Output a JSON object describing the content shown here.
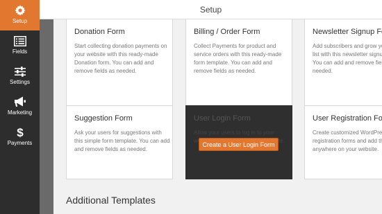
{
  "app": {
    "title": "Setup"
  },
  "sidebar": {
    "items": [
      {
        "label": "Setup",
        "icon": "gear-icon",
        "active": true
      },
      {
        "label": "Fields",
        "icon": "list-icon",
        "active": false
      },
      {
        "label": "Settings",
        "icon": "sliders-icon",
        "active": false
      },
      {
        "label": "Marketing",
        "icon": "megaphone-icon",
        "active": false
      },
      {
        "label": "Payments",
        "icon": "dollar-icon",
        "active": false
      }
    ]
  },
  "templates": [
    {
      "title": "Donation Form",
      "desc": "Start collecting donation payments on your website with this ready-made Donation form. You can add and remove fields as needed."
    },
    {
      "title": "Billing / Order Form",
      "desc": "Collect Payments for product and service orders with this ready-made form template. You can add and remove fields as needed."
    },
    {
      "title": "Newsletter Signup Form",
      "desc": "Add subscribers and grow your email list with this newsletter signup form. You can add and remove fields as needed."
    },
    {
      "title": "Suggestion Form",
      "desc": "Ask your users for suggestions with this simple form template. You can add and remove fields as needed."
    },
    {
      "title": "User Login Form",
      "desc": "Allow your users to log in to your website with this login form template.",
      "cta": "Create a User Login Form"
    },
    {
      "title": "User Registration Form",
      "desc": "Create customized WordPress user registration forms and add them anywhere on your website."
    }
  ],
  "additional": {
    "title": "Additional Templates"
  },
  "colors": {
    "accent": "#e27730",
    "sidebar": "#2d2d2d"
  }
}
